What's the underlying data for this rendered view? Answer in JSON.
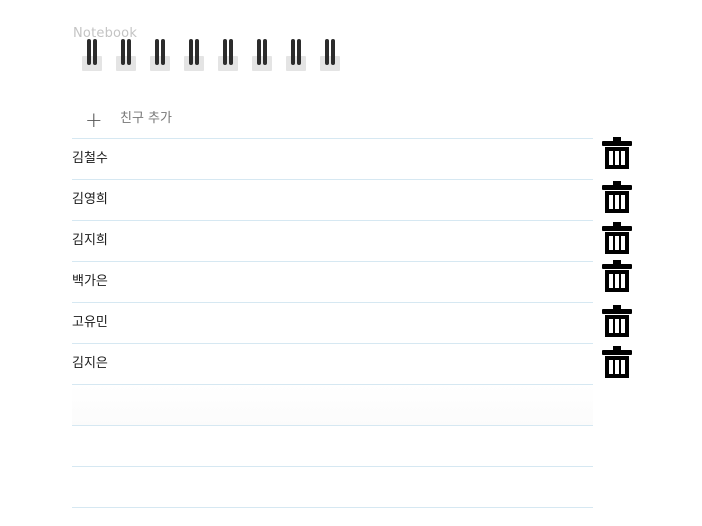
{
  "notebook": {
    "label": "Notebook",
    "ring_count": 8
  },
  "add_friend": {
    "icon": "plus-icon",
    "symbol": "+",
    "label": "친구 추가"
  },
  "friends": [
    {
      "name": "김철수"
    },
    {
      "name": "김영희"
    },
    {
      "name": "김지희"
    },
    {
      "name": "백가은"
    },
    {
      "name": "고유민"
    },
    {
      "name": "김지은"
    }
  ],
  "empty_row_count": 3,
  "delete_icon": "trash-icon",
  "colors": {
    "line": "#d6e8f2",
    "text": "#1a1a1a",
    "muted": "#777777",
    "icon": "#000000"
  }
}
